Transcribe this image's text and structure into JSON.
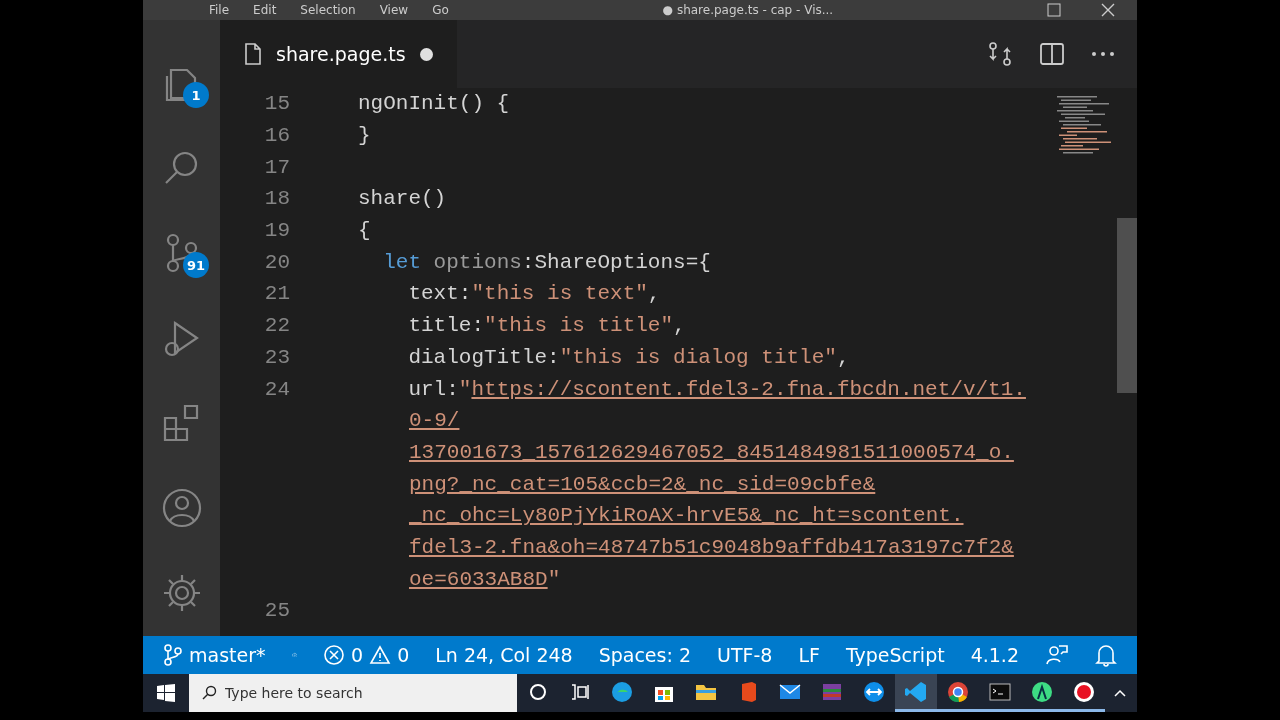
{
  "title_bar": {
    "menu": [
      "File",
      "Edit",
      "Selection",
      "View",
      "Go"
    ],
    "title": "● share.page.ts - cap - Vis..."
  },
  "activity_bar": [
    {
      "kind": "explorer",
      "badge": "1"
    },
    {
      "kind": "search"
    },
    {
      "kind": "source-control",
      "badge": "91"
    },
    {
      "kind": "run"
    },
    {
      "kind": "extensions"
    },
    {
      "kind": "account"
    },
    {
      "kind": "settings"
    }
  ],
  "tabs": [
    {
      "label": "share.page.ts",
      "selected": true,
      "dirty": true
    }
  ],
  "editor": {
    "rows": [
      {
        "number": "15",
        "tokens": [
          {
            "kind": "plain",
            "text": "ngOnInit() {"
          }
        ]
      },
      {
        "number": "16",
        "tokens": [
          {
            "kind": "plain",
            "text": "}"
          }
        ]
      },
      {
        "number": "17",
        "tokens": []
      },
      {
        "number": "18",
        "tokens": [
          {
            "kind": "plain",
            "text": "share()"
          }
        ]
      },
      {
        "number": "19",
        "tokens": [
          {
            "kind": "plain",
            "text": "{"
          }
        ]
      },
      {
        "number": "20",
        "tokens": [
          {
            "kind": "keyword",
            "text": "  let"
          },
          {
            "kind": "unused",
            "text": " options"
          },
          {
            "kind": "plain",
            "text": ":ShareOptions={"
          }
        ]
      },
      {
        "number": "21",
        "tokens": [
          {
            "kind": "plain",
            "text": "    text:"
          },
          {
            "kind": "string",
            "text": "\"this is text\""
          },
          {
            "kind": "plain",
            "text": ","
          }
        ]
      },
      {
        "number": "22",
        "tokens": [
          {
            "kind": "plain",
            "text": "    title:"
          },
          {
            "kind": "string",
            "text": "\"this is title\""
          },
          {
            "kind": "plain",
            "text": ","
          }
        ]
      },
      {
        "number": "23",
        "tokens": [
          {
            "kind": "plain",
            "text": "    dialogTitle:"
          },
          {
            "kind": "string",
            "text": "\"this is dialog title\""
          },
          {
            "kind": "plain",
            "text": ","
          }
        ]
      },
      {
        "number": "24",
        "tokens": [
          {
            "kind": "plain",
            "text": "    url:"
          },
          {
            "kind": "string",
            "text": "\""
          },
          {
            "kind": "link",
            "text": "https://scontent.fdel3-2.fna.fbcdn.net/v/t1."
          }
        ]
      },
      {
        "tokens": [
          {
            "kind": "link",
            "text": "0-9/"
          }
        ]
      },
      {
        "tokens": [
          {
            "kind": "link",
            "text": "137001673_157612629467052_8451484981511000574_o."
          }
        ]
      },
      {
        "tokens": [
          {
            "kind": "link",
            "text": "png?_nc_cat=105&ccb=2&_nc_sid=09cbfe&"
          }
        ]
      },
      {
        "tokens": [
          {
            "kind": "link",
            "text": "_nc_ohc=Ly80PjYkiRoAX-hrvE5&_nc_ht=scontent."
          }
        ]
      },
      {
        "tokens": [
          {
            "kind": "link",
            "text": "fdel3-2.fna&oh=48747b51c9048b9affdb417a3197c7f2&"
          }
        ]
      },
      {
        "tokens": [
          {
            "kind": "link",
            "text": "oe=6033AB8D"
          },
          {
            "kind": "string",
            "text": "\""
          }
        ]
      },
      {
        "number": "25",
        "tokens": []
      }
    ]
  },
  "status_bar": {
    "branch": "master*",
    "errors": "0",
    "warnings": "0",
    "items": [
      "Ln 24, Col 248",
      "Spaces: 2",
      "UTF-8",
      "LF",
      "TypeScript",
      "4.1.2"
    ]
  },
  "taskbar": {
    "search": {
      "placeholder": "Type here to search"
    },
    "apps": [
      {
        "kind": "edge",
        "running": false,
        "selected": false
      },
      {
        "kind": "store",
        "running": false,
        "selected": false
      },
      {
        "kind": "explorer",
        "running": false,
        "selected": false
      },
      {
        "kind": "office",
        "running": false,
        "selected": false
      },
      {
        "kind": "mail",
        "running": false,
        "selected": false
      },
      {
        "kind": "archive",
        "running": false,
        "selected": false
      },
      {
        "kind": "remote",
        "running": false,
        "selected": false
      },
      {
        "kind": "vscode",
        "running": true,
        "selected": true
      },
      {
        "kind": "chrome",
        "running": true,
        "selected": false
      },
      {
        "kind": "terminal",
        "running": true,
        "selected": false
      },
      {
        "kind": "android",
        "running": true,
        "selected": false
      },
      {
        "kind": "recorder",
        "running": true,
        "selected": false
      }
    ]
  }
}
